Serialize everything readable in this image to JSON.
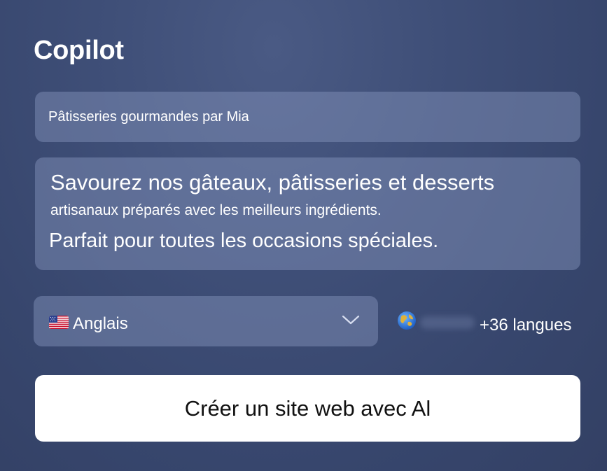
{
  "header": {
    "title": "Copilot"
  },
  "form": {
    "site_name": {
      "value": "Pâtisseries gourmandes par Mia"
    },
    "description": {
      "line1": "Savourez nos gâteaux, pâtisseries et desserts",
      "line2": "artisanaux préparés avec les meilleurs ingrédients.",
      "line3": "Parfait pour toutes les occasions spéciales."
    },
    "language": {
      "flag_icon": "us-flag-icon",
      "selected": "Anglais"
    },
    "more_languages": {
      "icon": "globe-icon",
      "label": "+36 langues"
    },
    "submit": {
      "label": "Créer un site web avec Al"
    }
  },
  "colors": {
    "background": "#3d4c74",
    "field": "#6b7aa1",
    "button": "#ffffff",
    "button_text": "#111111"
  }
}
